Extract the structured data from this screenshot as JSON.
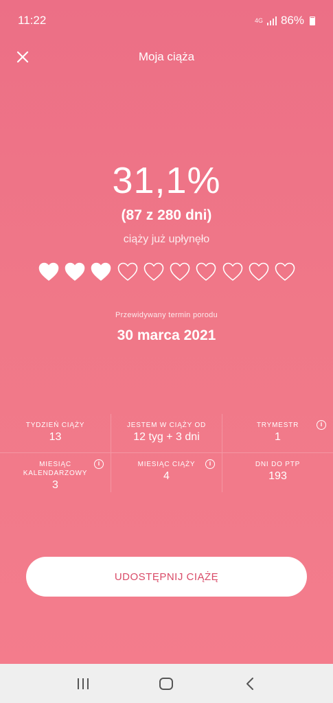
{
  "status_bar": {
    "time": "11:22",
    "network_label": "4G",
    "battery": "86%"
  },
  "header": {
    "title": "Moja ciąża",
    "close_icon": "close-icon"
  },
  "progress": {
    "percent": "31,1%",
    "days": "(87 z 280 dni)",
    "elapsed_text": "ciąży już upłynęło",
    "hearts_total": 10,
    "hearts_filled": 3
  },
  "due_date": {
    "label": "Przewidywany termin porodu",
    "value": "30 marca 2021"
  },
  "stats": {
    "week": {
      "label": "TYDZIEŃ CIĄŻY",
      "value": "13"
    },
    "since": {
      "label": "JESTEM W CIĄŻY OD",
      "value": "12 tyg + 3 dni"
    },
    "trimester": {
      "label": "TRYMESTR",
      "value": "1"
    },
    "calendar_month": {
      "label": "MIESIĄC KALENDARZOWY",
      "value": "3"
    },
    "pregnancy_month": {
      "label": "MIESIĄC CIĄŻY",
      "value": "4"
    },
    "days_to_due": {
      "label": "DNI DO PTP",
      "value": "193"
    }
  },
  "share_button": {
    "label": "UDOSTĘPNIJ CIĄŻĘ"
  },
  "colors": {
    "background_top": "#ec6f86",
    "background_bottom": "#f47d8d",
    "button_text": "#d94a67",
    "nav_bar": "#efefef"
  }
}
